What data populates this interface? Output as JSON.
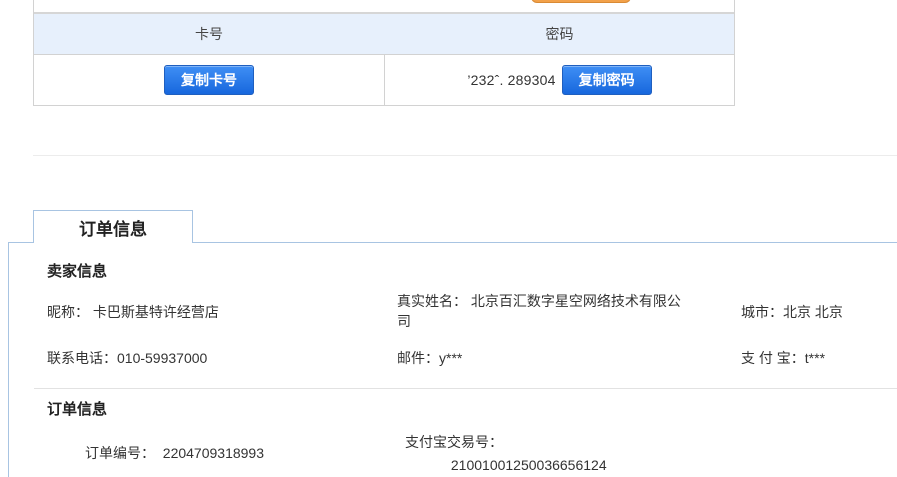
{
  "card": {
    "headers": {
      "card_no": "卡号",
      "password": "密码"
    },
    "copy_card_button": "复制卡号",
    "password_value": "’232ˆ.    289304",
    "copy_password_button": "复制密码"
  },
  "order_tab": {
    "label": "订单信息"
  },
  "seller": {
    "title": "卖家信息",
    "nickname": "昵称：  卡巴斯基特许经营店",
    "real_name": "真实姓名：  北京百汇数字星空网络技术有限公\n司",
    "city": "城市：北京 北京",
    "phone": "联系电话：010-59937000",
    "email": "邮件：y***",
    "alipay": "支  付  宝：t***"
  },
  "order": {
    "title": "订单信息",
    "order_no": "订单编号：      2204709318993",
    "trade_no_label": "支付宝交易号：",
    "trade_no_value": " 21001001250036656124"
  },
  "colors": {
    "header_bg": "#e7f0fc",
    "button_blue": "#1767dd",
    "tab_border": "#a8c4e2",
    "orange": "#f2a14a"
  }
}
